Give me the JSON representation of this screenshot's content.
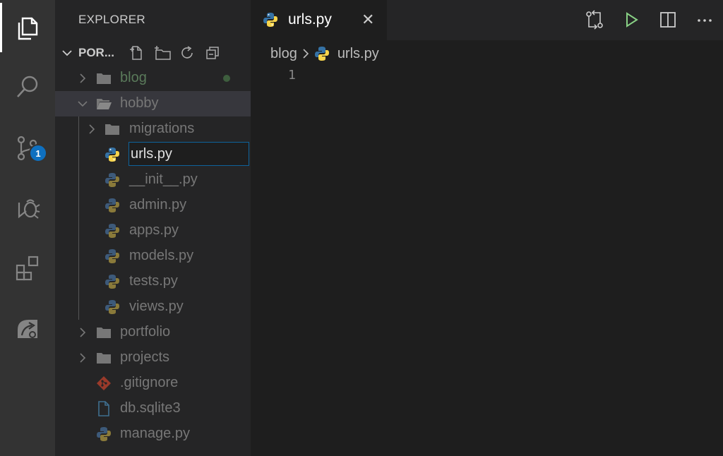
{
  "activity_bar": {
    "items": [
      {
        "icon": "files-icon",
        "active": true
      },
      {
        "icon": "search-icon"
      },
      {
        "icon": "source-control-icon",
        "badge": "1"
      },
      {
        "icon": "debug-icon"
      },
      {
        "icon": "extensions-icon"
      },
      {
        "icon": "remote-explorer-icon"
      }
    ]
  },
  "sidebar": {
    "title": "EXPLORER",
    "section_name": "POR...",
    "tree": [
      {
        "label": "blog",
        "kind": "folder",
        "state": "collapsed",
        "depth": 0,
        "modified": true
      },
      {
        "label": "hobby",
        "kind": "folder",
        "state": "expanded",
        "depth": 0,
        "selected": true
      },
      {
        "label": "migrations",
        "kind": "folder",
        "state": "collapsed",
        "depth": 1
      },
      {
        "label": "urls.py",
        "kind": "python",
        "depth": 1,
        "editing": true
      },
      {
        "label": "__init__.py",
        "kind": "python",
        "depth": 1
      },
      {
        "label": "admin.py",
        "kind": "python",
        "depth": 1
      },
      {
        "label": "apps.py",
        "kind": "python",
        "depth": 1
      },
      {
        "label": "models.py",
        "kind": "python",
        "depth": 1
      },
      {
        "label": "tests.py",
        "kind": "python",
        "depth": 1
      },
      {
        "label": "views.py",
        "kind": "python",
        "depth": 1
      },
      {
        "label": "portfolio",
        "kind": "folder",
        "state": "collapsed",
        "depth": 0
      },
      {
        "label": "projects",
        "kind": "folder",
        "state": "collapsed",
        "depth": 0
      },
      {
        "label": ".gitignore",
        "kind": "git",
        "depth": 0
      },
      {
        "label": "db.sqlite3",
        "kind": "file",
        "depth": 0
      },
      {
        "label": "manage.py",
        "kind": "python",
        "depth": 0
      }
    ]
  },
  "tabs": [
    {
      "label": "urls.py",
      "icon": "python-icon",
      "close": "✕"
    }
  ],
  "breadcrumb": {
    "folder": "blog",
    "file": "urls.py"
  },
  "editor": {
    "line_numbers": [
      "1"
    ]
  },
  "colors": {
    "accent": "#0e70c0",
    "run": "#89d185",
    "python_blue": "#3572A5",
    "python_yellow": "#f7d44c",
    "git": "#e0533e",
    "file_blue": "#519aba"
  }
}
